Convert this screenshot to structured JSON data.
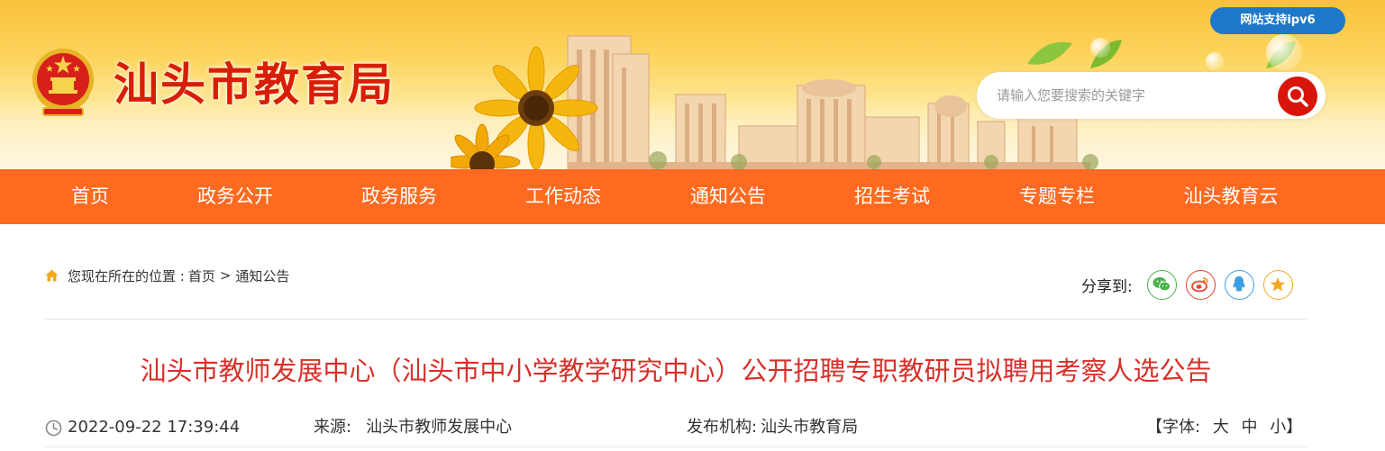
{
  "header": {
    "site_title": "汕头市教育局",
    "ipv6_badge": "网站支持ipv6",
    "search": {
      "placeholder": "请输入您要搜索的关键字",
      "value": ""
    }
  },
  "nav": {
    "items": [
      {
        "label": "首页"
      },
      {
        "label": "政务公开"
      },
      {
        "label": "政务服务"
      },
      {
        "label": "工作动态"
      },
      {
        "label": "通知公告"
      },
      {
        "label": "招生考试"
      },
      {
        "label": "专题专栏"
      },
      {
        "label": "汕头教育云"
      }
    ]
  },
  "breadcrumb": {
    "prefix": "您现在所在的位置 :",
    "items": [
      {
        "label": "首页"
      },
      {
        "label": "通知公告"
      }
    ],
    "separator": ">"
  },
  "share": {
    "label": "分享到:",
    "targets": [
      {
        "name": "wechat",
        "color": "#46b34b"
      },
      {
        "name": "weibo",
        "color": "#e4432d"
      },
      {
        "name": "qq",
        "color": "#3a9fe2"
      },
      {
        "name": "qzone",
        "color": "#f5a623"
      }
    ]
  },
  "article": {
    "title": "汕头市教师发展中心（汕头市中小学教学研究中心）公开招聘专职教研员拟聘用考察人选公告",
    "datetime": "2022-09-22 17:39:44",
    "source_label": "来源:",
    "source": "汕头市教师发展中心",
    "publisher_label": "发布机构:",
    "publisher": "汕头市教育局",
    "font_size": {
      "open": "【字体:",
      "large": "大",
      "medium": "中",
      "small": "小",
      "close": "】"
    }
  },
  "colors": {
    "nav_bg": "#fd6a20",
    "title_red": "#d8302a",
    "brand_red": "#d81e06",
    "ipv6_blue": "#1e77c9"
  },
  "icons": {
    "emblem": "national-emblem-icon",
    "search": "search-icon",
    "home": "home-icon",
    "clock": "clock-icon"
  }
}
